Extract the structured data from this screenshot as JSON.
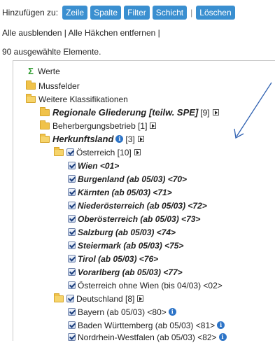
{
  "toolbar": {
    "label": "Hinzufügen zu:",
    "buttons": [
      "Zeile",
      "Spalte",
      "Filter",
      "Schicht"
    ],
    "separator": "|",
    "delete_label": "Löschen"
  },
  "links": {
    "hide_all": "Alle ausblenden",
    "sep1": "|",
    "remove_checks": "Alle Häkchen entfernen",
    "sep2": "|"
  },
  "selected_count": "90 ausgewählte Elemente.",
  "tree": {
    "werte": "Werte",
    "mussfelder": "Mussfelder",
    "weitere": "Weitere Klassifikationen",
    "regionale": "Regionale Gliederung [teilw. SPE]",
    "regionale_count": "[9]",
    "beherbergung": "Beherbergungsbetrieb [1]",
    "herkunftsland": "Herkunftsland",
    "herkunftsland_count": "[3]",
    "oesterreich": "Österreich [10]",
    "austria_items": [
      "Wien <01>",
      "Burgenland (ab 05/03) <70>",
      "Kärnten (ab 05/03) <71>",
      "Niederösterreich (ab 05/03) <72>",
      "Oberösterreich (ab 05/03) <73>",
      "Salzburg (ab 05/03) <74>",
      "Steiermark (ab 05/03) <75>",
      "Tirol (ab 05/03) <76>",
      "Vorarlberg (ab 05/03) <77>"
    ],
    "oesterreich_ohne_wien": "Österreich ohne Wien (bis 04/03) <02>",
    "deutschland": "Deutschland [8]",
    "germany_items": [
      "Bayern (ab 05/03) <80>",
      "Baden Württemberg (ab 05/03) <81>",
      "Nordrhein-Westfalen (ab 05/03) <82>"
    ],
    "info_glyph": "i"
  },
  "colors": {
    "button_blue": "#3a8fd0",
    "folder_yellow": "#f0c24a",
    "sigma_green": "#2e9b2e",
    "info_blue": "#2d74c7",
    "arrow_blue": "#2d5fb0"
  },
  "icons": [
    "sigma-icon",
    "folder-icon",
    "checkbox-icon",
    "expand-arrow-icon",
    "info-icon"
  ]
}
